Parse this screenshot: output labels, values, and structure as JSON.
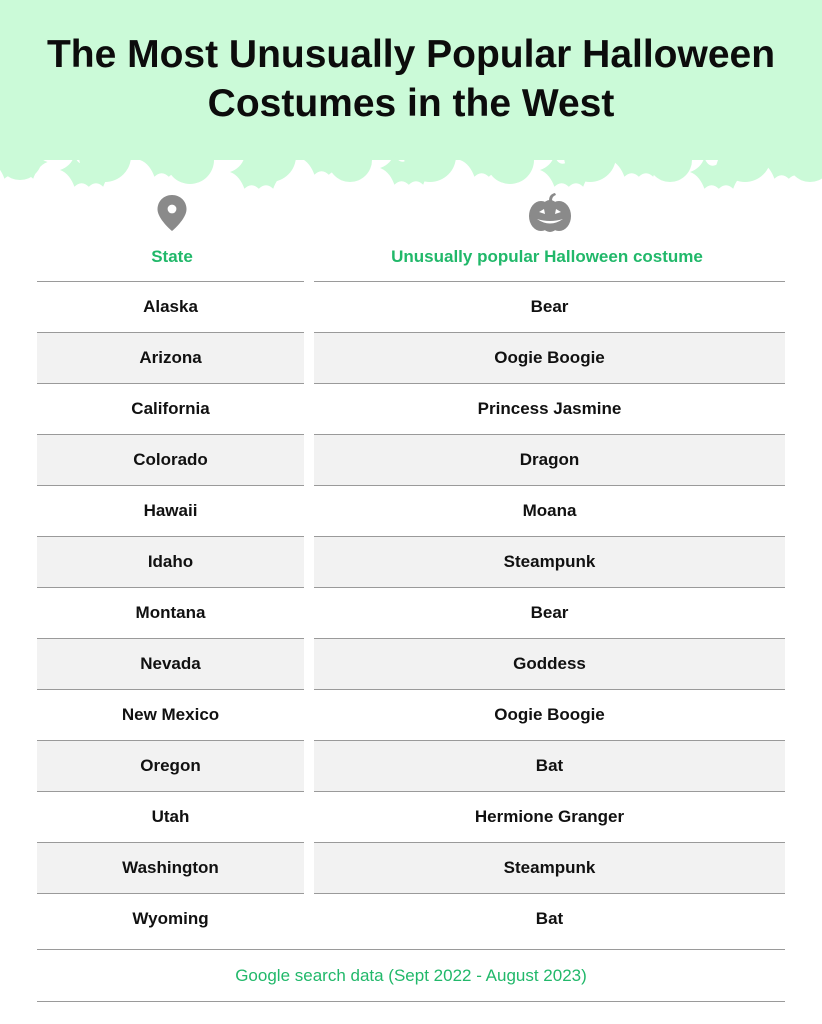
{
  "title": "The Most Unusually Popular Halloween Costumes in the West",
  "header": {
    "state_icon": "location-pin-icon",
    "costume_icon": "pumpkin-icon",
    "state_label": "State",
    "costume_label": "Unusually popular Halloween costume"
  },
  "colors": {
    "header_band": "#cbfad8",
    "bat_silhouettes": "#cbfad8",
    "accent_green": "#21b86a",
    "icon_gray": "#8a8a8a",
    "row_shade": "#f2f2f2"
  },
  "chart_data": {
    "type": "table",
    "title": "The Most Unusually Popular Halloween Costumes in the West",
    "columns": [
      "State",
      "Unusually popular Halloween costume"
    ],
    "rows": [
      {
        "state": "Alaska",
        "costume": "Bear"
      },
      {
        "state": "Arizona",
        "costume": "Oogie Boogie"
      },
      {
        "state": "California",
        "costume": "Princess Jasmine"
      },
      {
        "state": "Colorado",
        "costume": "Dragon"
      },
      {
        "state": "Hawaii",
        "costume": "Moana"
      },
      {
        "state": "Idaho",
        "costume": "Steampunk"
      },
      {
        "state": "Montana",
        "costume": "Bear"
      },
      {
        "state": "Nevada",
        "costume": "Goddess"
      },
      {
        "state": "New Mexico",
        "costume": "Oogie Boogie"
      },
      {
        "state": "Oregon",
        "costume": "Bat"
      },
      {
        "state": "Utah",
        "costume": "Hermione Granger"
      },
      {
        "state": "Washington",
        "costume": "Steampunk"
      },
      {
        "state": "Wyoming",
        "costume": "Bat"
      }
    ],
    "source": "Google search data (Sept 2022 - August 2023)"
  }
}
